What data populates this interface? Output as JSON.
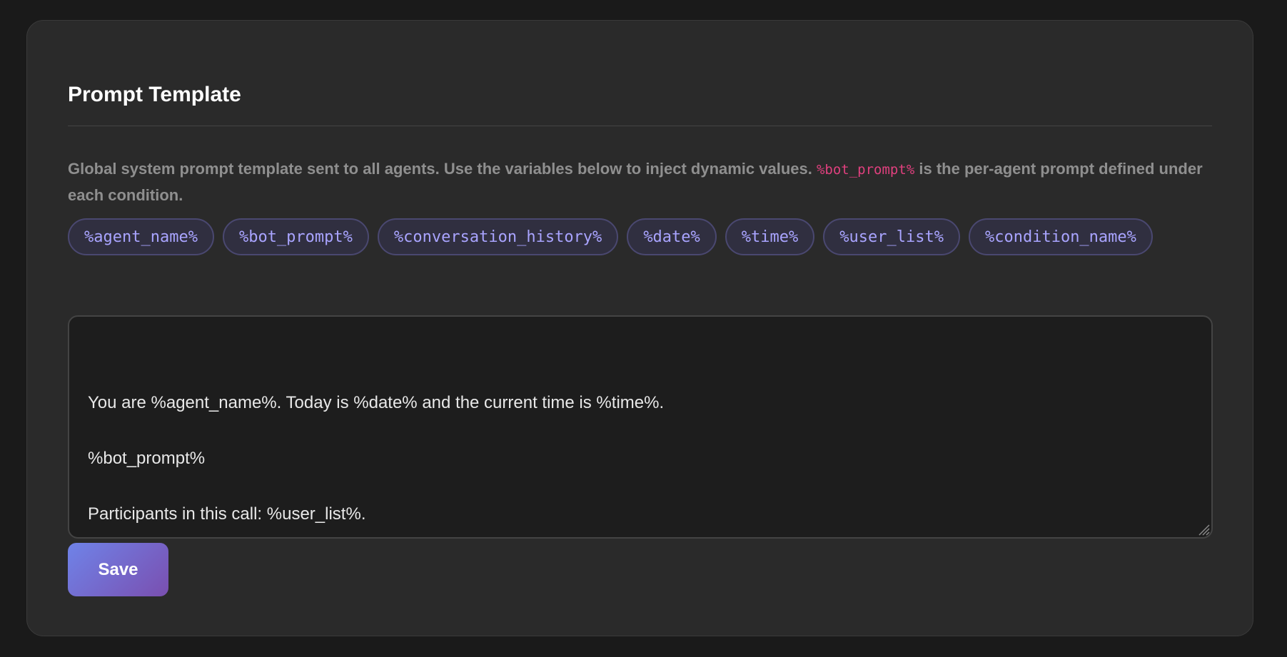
{
  "section": {
    "title": "Prompt Template"
  },
  "description": {
    "text_before": "Global system prompt template sent to all agents. Use the variables below to inject dynamic values. ",
    "highlight": "%bot_prompt%",
    "text_after": " is the per-agent prompt defined under each condition."
  },
  "variables": [
    "%agent_name%",
    "%bot_prompt%",
    "%conversation_history%",
    "%date%",
    "%time%",
    "%user_list%",
    "%condition_name%"
  ],
  "editor": {
    "value": "You are %agent_name%. Today is %date% and the current time is %time%.\n\n%bot_prompt%\n\nParticipants in this call: %user_list%.\n\nRecent conversation:\n%conversation_history%"
  },
  "actions": {
    "save_label": "Save"
  },
  "colors": {
    "accent_start": "#6f83e8",
    "accent_end": "#7a4fb0",
    "variable_text": "#a9a4ff",
    "highlight_text": "#e0407e"
  }
}
